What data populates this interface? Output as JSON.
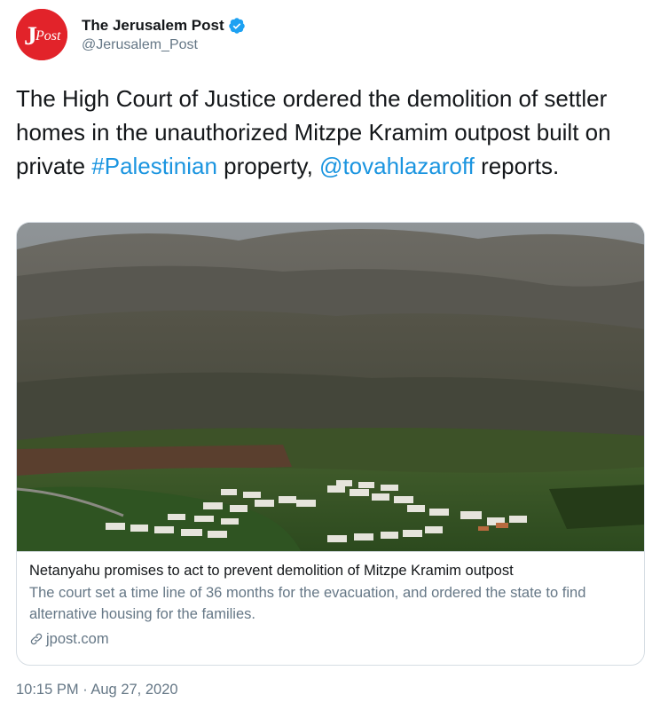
{
  "author": {
    "display_name": "The Jerusalem Post",
    "handle": "@Jerusalem_Post",
    "avatar_text": "JPost",
    "verified": true
  },
  "tweet": {
    "text_part1": "The High Court of Justice ordered the demolition of settler homes in the unauthorized Mitzpe Kramim outpost built on private ",
    "hashtag": "#Palestinian",
    "text_part2": " property, ",
    "mention": "@tovahlazaroff",
    "text_part3": " reports."
  },
  "card": {
    "image_alt": "Aerial view of Mitzpe Kramim outpost below green hills",
    "title": "Netanyahu promises to act to prevent demolition of Mitzpe Kramim outpost",
    "description": "The court set a time line of 36 months for the evacuation, and ordered the state to find alternative housing for the families.",
    "domain": "jpost.com",
    "link_icon": "link-icon"
  },
  "timestamp": "10:15 PM · Aug 27, 2020",
  "colors": {
    "link": "#1b95e0",
    "avatar_bg": "#e2232a",
    "verified": "#1da1f2",
    "secondary_text": "#657786"
  }
}
